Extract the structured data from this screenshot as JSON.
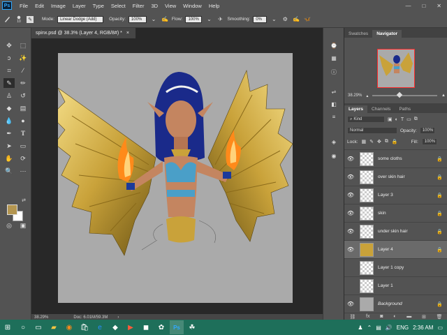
{
  "menubar": {
    "logo": "Ps",
    "items": [
      "File",
      "Edit",
      "Image",
      "Layer",
      "Type",
      "Select",
      "Filter",
      "3D",
      "View",
      "Window",
      "Help"
    ],
    "win_min": "—",
    "win_max": "□",
    "win_close": "✕"
  },
  "options": {
    "brush_size": "10",
    "mode_label": "Mode:",
    "mode_value": "Linear Dodge (Add)",
    "opacity_label": "Opacity:",
    "opacity_value": "100%",
    "flow_label": "Flow:",
    "flow_value": "100%",
    "smoothing_label": "Smoothing:",
    "smoothing_value": "0%"
  },
  "document": {
    "tab_title": "spinx.psd @ 38.3% (Layer 4, RGB/8#) *",
    "tab_close": "×",
    "zoom": "38.29%",
    "doc_info": "Doc: 6.01M/59.3M"
  },
  "navigator": {
    "tabs": [
      "Swatches",
      "Navigator"
    ],
    "zoom": "38.29%"
  },
  "layers": {
    "tabs": [
      "Layers",
      "Channels",
      "Paths"
    ],
    "filter_label": "Kind",
    "blend_mode": "Normal",
    "opacity_label": "Opacity:",
    "opacity_value": "100%",
    "lock_label": "Lock:",
    "fill_label": "Fill:",
    "fill_value": "100%",
    "rows": [
      {
        "name": "some cloths",
        "visible": true
      },
      {
        "name": "over skin hair",
        "visible": true
      },
      {
        "name": "Layer 3",
        "visible": true
      },
      {
        "name": "skin",
        "visible": true
      },
      {
        "name": "under skin hair",
        "visible": true
      },
      {
        "name": "Layer 4",
        "visible": true
      },
      {
        "name": "Layer 1 copy",
        "visible": false
      },
      {
        "name": "Layer 1",
        "visible": false
      },
      {
        "name": "Background",
        "visible": true
      }
    ],
    "footer_icons": [
      "link-icon",
      "fx-icon",
      "mask-icon",
      "adjustment-icon",
      "folder-icon",
      "new-layer-icon",
      "trash-icon"
    ]
  },
  "taskbar": {
    "time": "2:36 AM",
    "lang": "ENG"
  },
  "colors": {
    "foreground": "#b49650",
    "background": "#ffffff",
    "taskbar": "#1e6f5a",
    "accent": "#31a8ff"
  }
}
